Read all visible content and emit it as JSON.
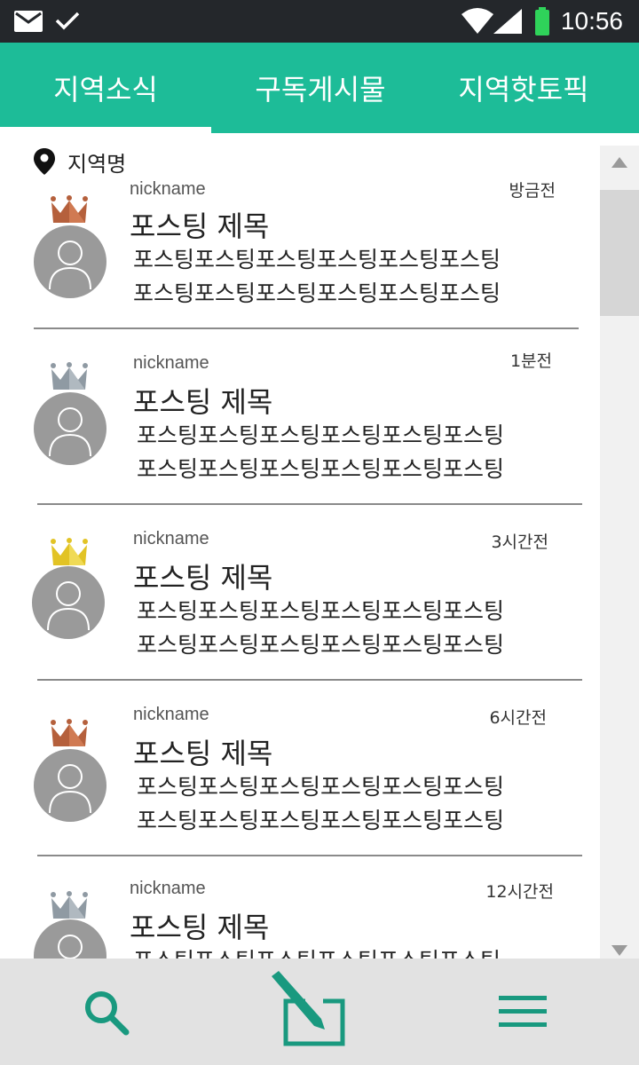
{
  "status_bar": {
    "time": "10:56"
  },
  "tabs": [
    {
      "label": "지역소식",
      "selected": true
    },
    {
      "label": "구독게시물",
      "selected": false
    },
    {
      "label": "지역핫토픽",
      "selected": false
    }
  ],
  "location": {
    "label": "지역명"
  },
  "posts": [
    {
      "nickname": "nickname",
      "time": "방금전",
      "title": "포스팅 제목",
      "body_line1": "포스팅포스팅포스팅포스팅포스팅포스팅",
      "body_line2": "포스팅포스팅포스팅포스팅포스팅포스팅",
      "crown": "bronze"
    },
    {
      "nickname": "nickname",
      "time": "1분전",
      "title": "포스팅 제목",
      "body_line1": "포스팅포스팅포스팅포스팅포스팅포스팅",
      "body_line2": "포스팅포스팅포스팅포스팅포스팅포스팅",
      "crown": "silver"
    },
    {
      "nickname": "nickname",
      "time": "3시간전",
      "title": "포스팅 제목",
      "body_line1": "포스팅포스팅포스팅포스팅포스팅포스팅",
      "body_line2": "포스팅포스팅포스팅포스팅포스팅포스팅",
      "crown": "gold"
    },
    {
      "nickname": "nickname",
      "time": "6시간전",
      "title": "포스팅 제목",
      "body_line1": "포스팅포스팅포스팅포스팅포스팅포스팅",
      "body_line2": "포스팅포스팅포스팅포스팅포스팅포스팅",
      "crown": "bronze"
    },
    {
      "nickname": "nickname",
      "time": "12시간전",
      "title": "포스팅 제목",
      "body_line1": "포스팅포스팅포스팅포스팅포스팅포스팅",
      "body_line2": "",
      "crown": "silver"
    }
  ],
  "crown_colors": {
    "bronze": "#b5603c",
    "silver": "#8f9aa3",
    "gold": "#e2c325"
  },
  "bottom_nav": [
    {
      "icon": "search-icon"
    },
    {
      "icon": "write-icon"
    },
    {
      "icon": "menu-icon"
    }
  ],
  "colors": {
    "accent": "#1dbc98",
    "icon_teal": "#19997f",
    "status_bar": "#24272b"
  }
}
